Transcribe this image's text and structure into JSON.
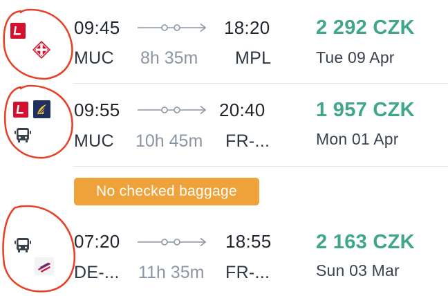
{
  "flights": [
    {
      "dep_time": "09:45",
      "arr_time": "18:20",
      "dep_code": "MUC",
      "arr_code": "MPL",
      "duration": "8h 35m",
      "price": "2 292 CZK",
      "date": "Tue 09 Apr"
    },
    {
      "dep_time": "09:55",
      "arr_time": "20:40",
      "dep_code": "MUC",
      "arr_code": "FR-...",
      "duration": "10h 45m",
      "price": "1 957 CZK",
      "date": "Mon 01 Apr"
    },
    {
      "dep_time": "07:20",
      "arr_time": "18:55",
      "dep_code": "DE-...",
      "arr_code": "FR-...",
      "duration": "11h 35m",
      "price": "2 163 CZK",
      "date": "Sun 03 Mar"
    }
  ],
  "badge": {
    "label": "No checked baggage"
  },
  "icons": {
    "carrier_1": "lufthansa-l-icon",
    "carrier_2": "swiss-cross-pattern-icon",
    "carrier_3": "ryanair-harp-icon",
    "bus": "bus-icon",
    "carrier_4": "eurowings-stripes-icon",
    "route": "route-stops-arrow-icon"
  },
  "colors": {
    "price": "#3fa68c",
    "badge": "#f0a23a",
    "carrier_red": "#d3112f",
    "carrier_navy": "#1f2f61",
    "annotation": "#e8412a"
  }
}
